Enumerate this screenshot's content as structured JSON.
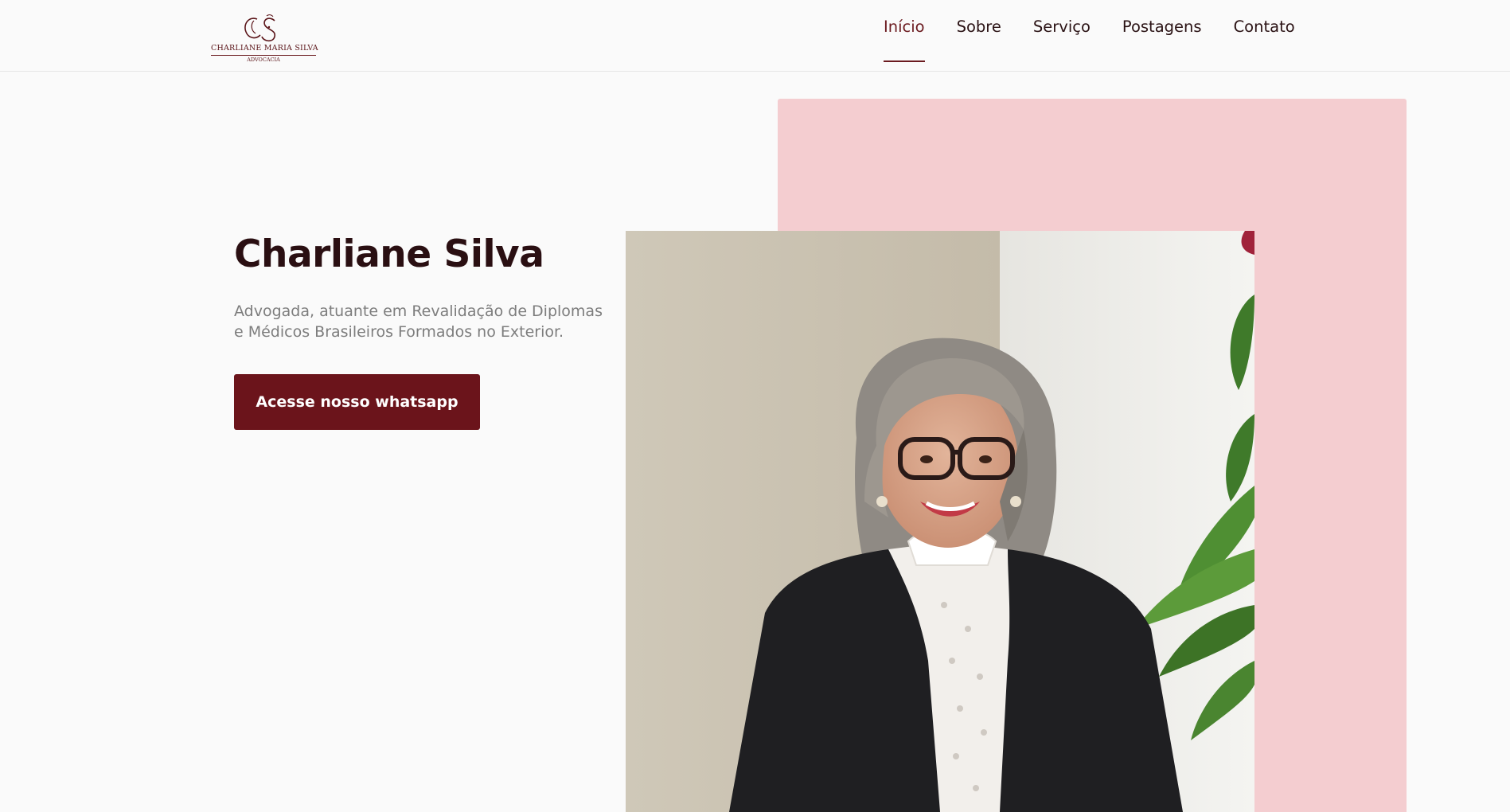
{
  "header": {
    "logo": {
      "monogram": "CS",
      "name": "CHARLIANE MARIA SILVA",
      "subtitle": "ADVOCACIA"
    },
    "nav": [
      {
        "label": "Início",
        "active": true
      },
      {
        "label": "Sobre",
        "active": false
      },
      {
        "label": "Serviço",
        "active": false
      },
      {
        "label": "Postagens",
        "active": false
      },
      {
        "label": "Contato",
        "active": false
      }
    ]
  },
  "hero": {
    "title": "Charliane Silva",
    "subtitle": "Advogada, atuante em Revalidação de Diplomas e Médicos Brasileiros Formados no Exterior.",
    "cta_label": "Acesse nosso whatsapp"
  },
  "colors": {
    "brand": "#6b141b",
    "panel": "#f4cdd0",
    "background": "#fafafa"
  }
}
